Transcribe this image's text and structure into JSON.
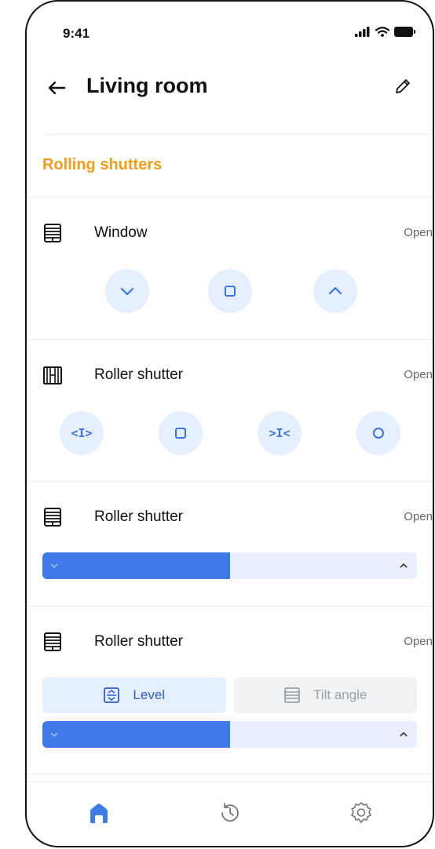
{
  "status_bar": {
    "time": "9:41"
  },
  "header": {
    "title": "Living room"
  },
  "section": {
    "title": "Rolling shutters"
  },
  "devices": [
    {
      "name": "Window",
      "status": "Open",
      "icon": "window-blind-icon"
    },
    {
      "name": "Roller shutter",
      "status": "Open",
      "icon": "curtain-icon"
    },
    {
      "name": "Roller shutter",
      "status": "Open",
      "icon": "window-blind-icon",
      "level_fraction": 0.5
    },
    {
      "name": "Roller shutter",
      "status": "Open",
      "icon": "window-blind-icon",
      "level_fraction": 0.5,
      "tabs": [
        {
          "label": "Level",
          "active": true
        },
        {
          "label": "Tilt angle",
          "active": false
        }
      ]
    }
  ],
  "controls": {
    "window": [
      "chevron-down-icon",
      "stop-icon",
      "chevron-up-icon"
    ],
    "curtain": {
      "open_label": "<I>",
      "close_label": ">I<",
      "stop": "stop-icon",
      "circle": "circle-icon"
    }
  },
  "nav": [
    "home-icon",
    "history-icon",
    "settings-icon"
  ],
  "colors": {
    "accent": "#3f7be8",
    "accent_light": "#e6efff",
    "section_title": "#f39c1a",
    "text": "#111111",
    "muted": "#666666"
  }
}
